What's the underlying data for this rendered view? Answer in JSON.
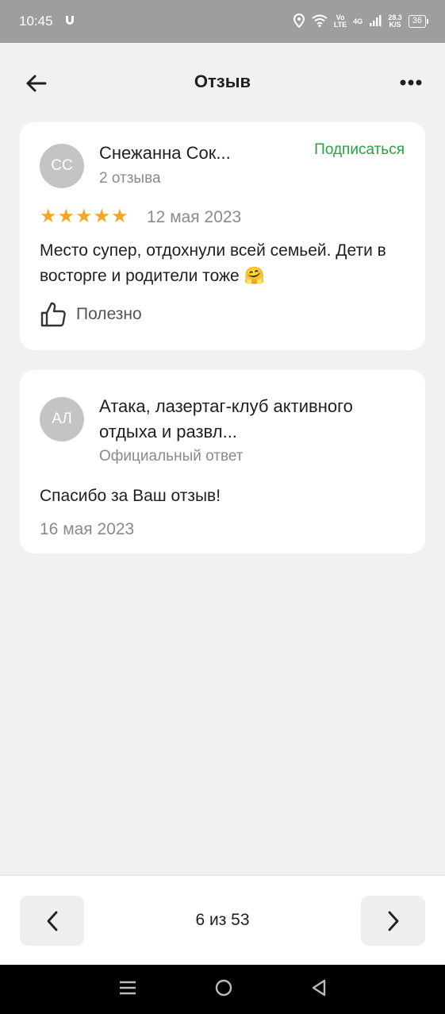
{
  "status_bar": {
    "time": "10:45",
    "network_top": "Vo",
    "network_bottom": "LTE",
    "gen": "4G",
    "speed_top": "28.3",
    "speed_bottom": "K/S",
    "battery": "36"
  },
  "header": {
    "title": "Отзыв",
    "back_icon": "arrow-left-icon",
    "more_icon": "more-dots-icon"
  },
  "review": {
    "avatar_initials": "СС",
    "author": "Снежанна Сок...",
    "author_reviews": "2 отзыва",
    "subscribe_label": "Подписаться",
    "rating": 5,
    "date": "12 мая 2023",
    "text": "Место супер, отдохнули всей семьей. Дети в восторге и родители тоже 🤗",
    "helpful_label": "Полезно"
  },
  "reply": {
    "avatar_initials": "АЛ",
    "org_name": "Атака, лазертаг-клуб активного отдыха и развл...",
    "org_sub": "Официальный ответ",
    "text": "Спасибо за Ваш отзыв!",
    "date": "16 мая 2023"
  },
  "pager": {
    "counter": "6 из 53"
  },
  "colors": {
    "accent_green": "#25a244",
    "star": "#f5a623",
    "background": "#f1f1f1"
  }
}
